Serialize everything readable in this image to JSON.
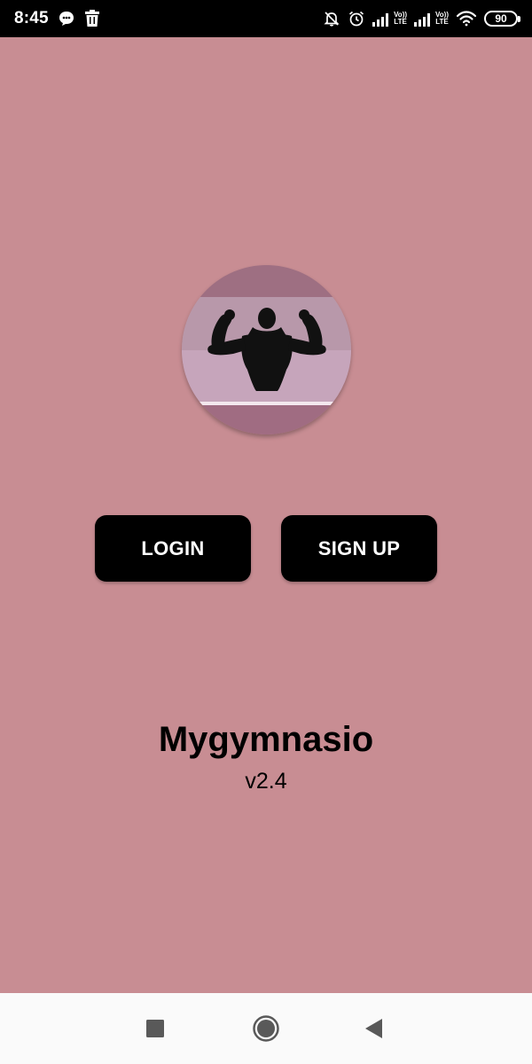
{
  "status_bar": {
    "time": "8:45",
    "notification_icons": [
      "chat-bubble-icon",
      "trash-icon"
    ],
    "system_icons": [
      "mute-bell-icon",
      "alarm-icon",
      "signal-icon",
      "signal-icon",
      "wifi-icon"
    ],
    "sim1_label_top": "Vo))",
    "sim1_label_bottom": "LTE",
    "sim2_label_top": "Vo))",
    "sim2_label_bottom": "LTE",
    "battery_level": "90"
  },
  "logo": {
    "icon": "bodybuilder-flex-icon",
    "stripe_colors": [
      "#9e6f82",
      "#b898aa",
      "#c6a5bb",
      "#f3e7ee",
      "#a06c82"
    ]
  },
  "buttons": {
    "login_label": "LOGIN",
    "signup_label": "SIGN UP"
  },
  "app": {
    "title": "Mygymnasio",
    "version": "v2.4"
  },
  "nav_bar": {
    "recents_icon": "square-icon",
    "home_icon": "circle-icon",
    "back_icon": "triangle-back-icon"
  },
  "colors": {
    "background": "#c88d93",
    "button_bg": "#000000",
    "button_text": "#ffffff",
    "status_bar": "#000000",
    "nav_bar": "#fafafa"
  }
}
